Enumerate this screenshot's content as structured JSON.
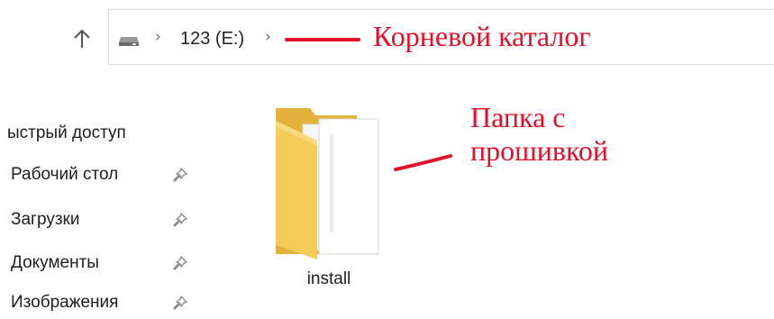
{
  "address_bar": {
    "up_icon": "arrow-up-icon",
    "drive_icon": "drive-icon",
    "path": [
      "123 (E:)"
    ],
    "separator": "›"
  },
  "annotations": {
    "root": "Корневой каталог",
    "folder": "Папка с прошивкой",
    "color": "#e3102a"
  },
  "sidebar": {
    "header": "ыстрый доступ",
    "items": [
      {
        "label": "Рабочий стол",
        "icon": "pin-icon"
      },
      {
        "label": "Загрузки",
        "icon": "pin-icon"
      },
      {
        "label": "Документы",
        "icon": "pin-icon"
      },
      {
        "label": "Изображения",
        "icon": "pin-icon"
      }
    ]
  },
  "content": {
    "items": [
      {
        "name": "install",
        "icon": "folder-icon"
      }
    ]
  },
  "colors": {
    "folder_yellow": "#f4cb59",
    "folder_back": "#e3b23c",
    "address_border": "#d9d9d9"
  }
}
